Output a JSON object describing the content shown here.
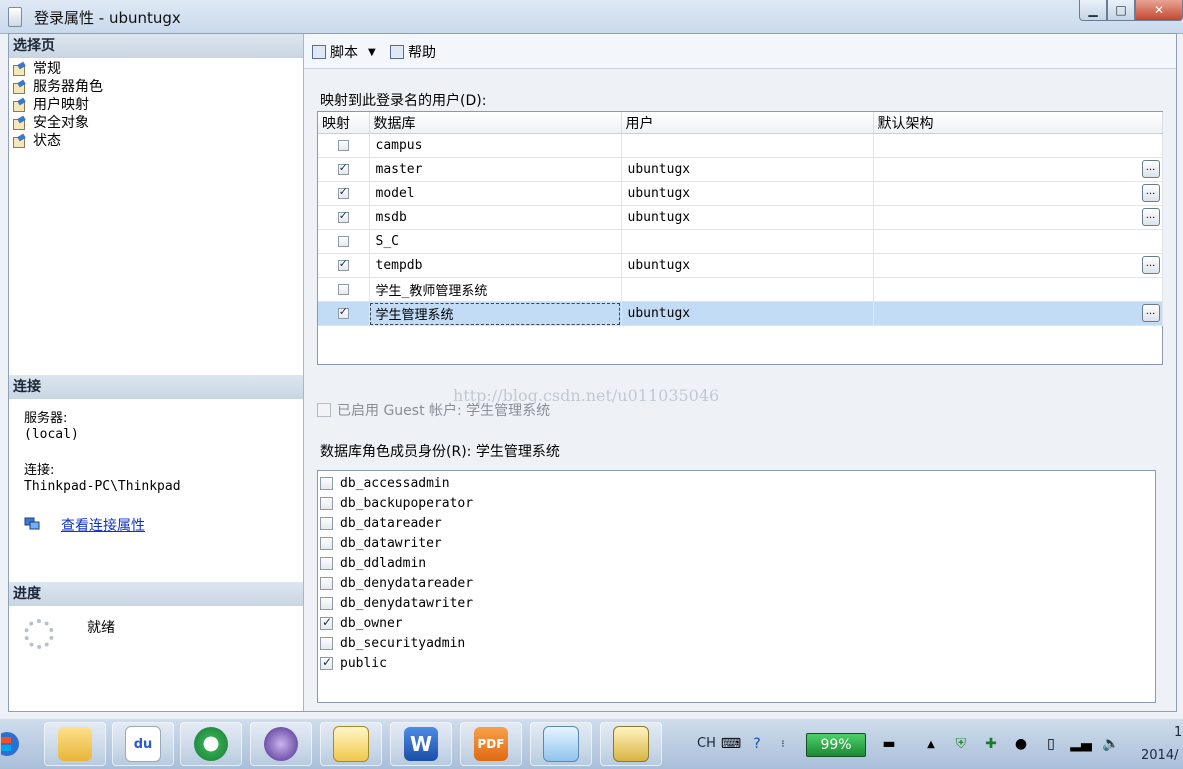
{
  "window": {
    "title": "登录属性 - ubuntugx"
  },
  "left": {
    "select_page_header": "选择页",
    "pages": [
      "常规",
      "服务器角色",
      "用户映射",
      "安全对象",
      "状态"
    ],
    "connection_header": "连接",
    "server_label": "服务器:",
    "server_value": "(local)",
    "connection_label": "连接:",
    "connection_value": "Thinkpad-PC\\Thinkpad",
    "view_connection_link": "查看连接属性",
    "progress_header": "进度",
    "progress_status": "就绪"
  },
  "toolbar": {
    "script_label": "脚本",
    "help_label": "帮助"
  },
  "mapping": {
    "label": "映射到此登录名的用户(D):",
    "columns": [
      "映射",
      "数据库",
      "用户",
      "默认架构"
    ],
    "rows": [
      {
        "mapped": false,
        "database": "campus",
        "user": "",
        "schema": "",
        "has_browse": false
      },
      {
        "mapped": true,
        "database": "master",
        "user": "ubuntugx",
        "schema": "",
        "has_browse": true
      },
      {
        "mapped": true,
        "database": "model",
        "user": "ubuntugx",
        "schema": "",
        "has_browse": true
      },
      {
        "mapped": true,
        "database": "msdb",
        "user": "ubuntugx",
        "schema": "",
        "has_browse": true
      },
      {
        "mapped": false,
        "database": "S_C",
        "user": "",
        "schema": "",
        "has_browse": false
      },
      {
        "mapped": true,
        "database": "tempdb",
        "user": "ubuntugx",
        "schema": "",
        "has_browse": true
      },
      {
        "mapped": false,
        "database": "学生_教师管理系统",
        "user": "",
        "schema": "",
        "has_browse": false
      },
      {
        "mapped": true,
        "database": "学生管理系统",
        "user": "ubuntugx",
        "schema": "",
        "has_browse": true,
        "selected": true
      }
    ],
    "browse_label": "..."
  },
  "guest": {
    "label": "已启用 Guest 帐户: 学生管理系统",
    "checked": false
  },
  "roles": {
    "label": "数据库角色成员身份(R): 学生管理系统",
    "items": [
      {
        "name": "db_accessadmin",
        "checked": false
      },
      {
        "name": "db_backupoperator",
        "checked": false
      },
      {
        "name": "db_datareader",
        "checked": false
      },
      {
        "name": "db_datawriter",
        "checked": false
      },
      {
        "name": "db_ddladmin",
        "checked": false
      },
      {
        "name": "db_denydatareader",
        "checked": false
      },
      {
        "name": "db_denydatawriter",
        "checked": false
      },
      {
        "name": "db_owner",
        "checked": true
      },
      {
        "name": "db_securityadmin",
        "checked": false
      },
      {
        "name": "public",
        "checked": true
      }
    ]
  },
  "watermark": "http://blog.csdn.net/u011035046",
  "taskbar": {
    "apps": [
      "file-explorer",
      "baidu",
      "ie",
      "eclipse",
      "snipping",
      "word",
      "pdf",
      "notepad",
      "ssms"
    ],
    "word_letter": "W",
    "pdf_label": "PDF",
    "baidu_label": "du",
    "lang": "CH",
    "battery": "99%",
    "clock_time": "1",
    "clock_date": "2014/"
  }
}
